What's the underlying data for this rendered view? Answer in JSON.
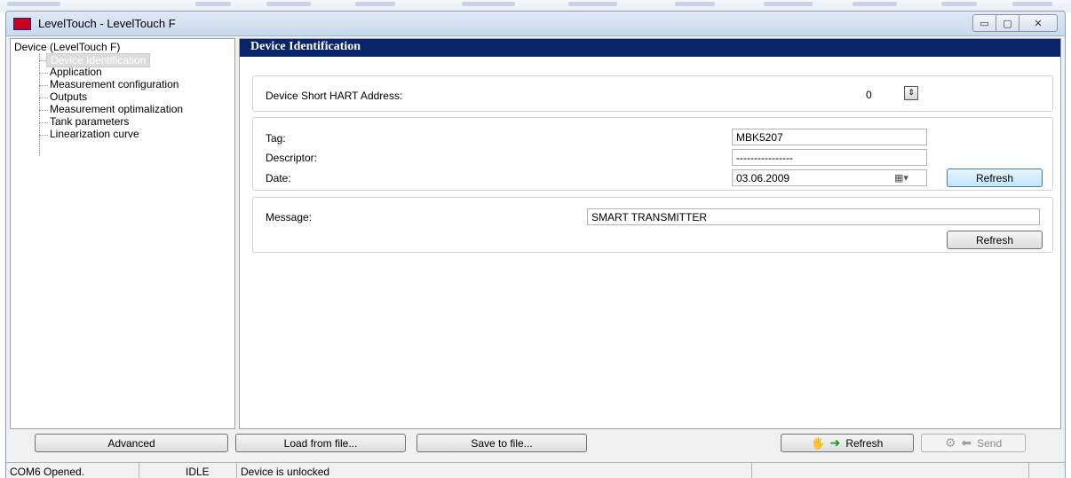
{
  "window": {
    "title": "LevelTouch - LevelTouch F"
  },
  "tree": {
    "root": "Device (LevelTouch F)",
    "items": [
      {
        "label": "Device Identification",
        "selected": true
      },
      {
        "label": "Application"
      },
      {
        "label": "Measurement configuration"
      },
      {
        "label": "Outputs"
      },
      {
        "label": "Measurement optimalization"
      },
      {
        "label": "Tank parameters"
      },
      {
        "label": "Linearization curve"
      }
    ]
  },
  "panel": {
    "header": "Device Identification",
    "hart": {
      "label": "Device Short HART Address:",
      "value": "0"
    },
    "tag": {
      "label": "Tag:",
      "value": "MBK5207"
    },
    "descriptor": {
      "label": "Descriptor:",
      "value": "----------------"
    },
    "date": {
      "label": "Date:",
      "value": "03.06.2009"
    },
    "refresh_label": "Refresh",
    "message": {
      "label": "Message:",
      "value": "SMART TRANSMITTER"
    },
    "message_refresh_label": "Refresh"
  },
  "bottom": {
    "advanced_label": "Advanced",
    "load_label": "Load from file...",
    "save_label": "Save to file...",
    "refresh_label": "Refresh",
    "send_label": "Send"
  },
  "status": {
    "port": "COM6 Opened.",
    "state": "IDLE",
    "lock": "Device is unlocked"
  }
}
